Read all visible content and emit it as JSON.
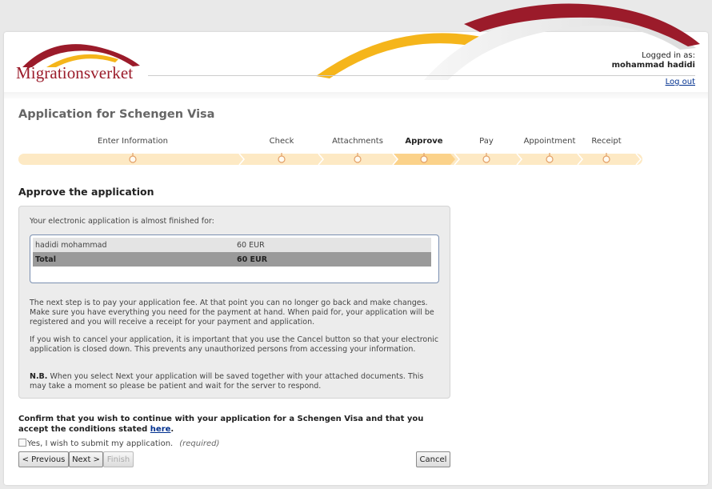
{
  "header": {
    "logo_text": "Migrationsverket",
    "logged_in_label": "Logged in as:",
    "user_name": "mohammad hadidi",
    "logout_label": "Log out"
  },
  "page_title": "Application for Schengen Visa",
  "steps": [
    {
      "label": "Enter Information",
      "active": false
    },
    {
      "label": "Check",
      "active": false
    },
    {
      "label": "Attachments",
      "active": false
    },
    {
      "label": "Approve",
      "active": true
    },
    {
      "label": "Pay",
      "active": false
    },
    {
      "label": "Appointment",
      "active": false
    },
    {
      "label": "Receipt",
      "active": false
    }
  ],
  "section_title": "Approve the application",
  "panel": {
    "intro": "Your electronic application is almost finished for:",
    "fees": [
      {
        "name": "hadidi mohammad",
        "amount": "60 EUR"
      },
      {
        "name": "Total",
        "amount": "60 EUR"
      }
    ],
    "p1": "The next step is to pay your application fee. At that point you can no longer go back and make changes. Make sure you have everything you need for the payment at hand. When paid for, your application will be registered and you will receive a receipt for your payment and application.",
    "p2": "If you wish to cancel your application, it is important that you use the Cancel button so that your electronic application is closed down. This prevents any unauthorized persons from accessing your information.",
    "p3_bold": "N.B.",
    "p3": "When you select Next your application will be saved together with your attached documents. This may take a moment so please be patient and wait for the server to respond."
  },
  "confirm": {
    "text": "Confirm that you wish to continue with your application for a Schengen Visa and that you accept the conditions stated",
    "link": "here",
    "end": "."
  },
  "checkbox": {
    "label": "Yes, I wish to submit my application.",
    "required": "(required)",
    "checked": false
  },
  "buttons": {
    "previous": "< Previous",
    "next": "Next >",
    "finish": "Finish",
    "cancel": "Cancel"
  },
  "colors": {
    "brand_red": "#9b1b2a",
    "brand_yellow": "#f5b51b",
    "progress_bg": "#fde9c4",
    "progress_active": "#fbd28a",
    "step_dot": "#e3a068"
  }
}
